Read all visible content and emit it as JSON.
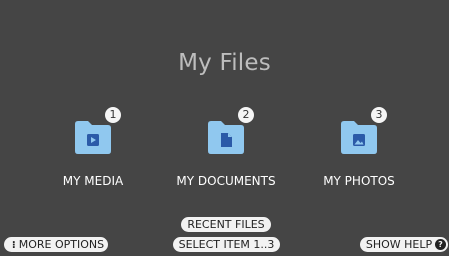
{
  "title": "My Files",
  "tiles": [
    {
      "label": "MY MEDIA",
      "badge": "1",
      "icon": "play-icon"
    },
    {
      "label": "MY DOCUMENTS",
      "badge": "2",
      "icon": "document-icon"
    },
    {
      "label": "MY PHOTOS",
      "badge": "3",
      "icon": "image-icon"
    }
  ],
  "footer": {
    "recent_files": "RECENT FILES",
    "select_item": "SELECT ITEM 1..3",
    "more_options": "MORE OPTIONS",
    "more_glyph": "⁝",
    "show_help": "SHOW HELP",
    "help_glyph": "?"
  },
  "colors": {
    "background": "#454545",
    "folder": "#90c8ef",
    "folder_glyph": "#2b5aa8",
    "pill": "#f2f2f2"
  }
}
